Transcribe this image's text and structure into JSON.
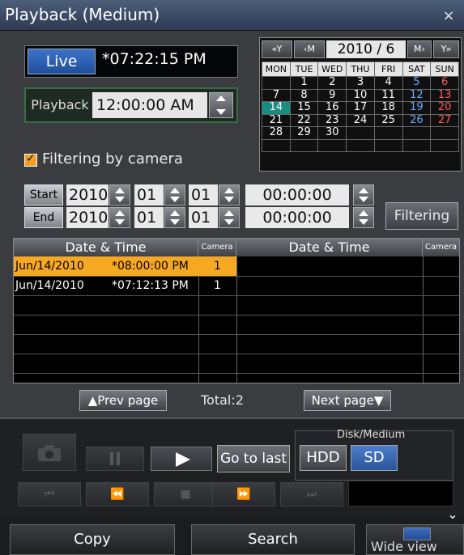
{
  "window": {
    "title": "Playback (Medium)",
    "close_icon": "×"
  },
  "live": {
    "button_label": "Live",
    "time": "*07:22:15 PM"
  },
  "playback": {
    "label": "Playback",
    "time": "12:00:00 AM"
  },
  "calendar": {
    "nav": {
      "prev_year": "«Y",
      "prev_month": "‹M",
      "next_month": "M›",
      "next_year": "Y»"
    },
    "year_month": "2010 /   6",
    "weekdays": [
      "MON",
      "TUE",
      "WED",
      "THU",
      "FRI",
      "SAT",
      "SUN"
    ],
    "weeks": [
      [
        "",
        "1",
        "2",
        "3",
        "4",
        "5",
        "6"
      ],
      [
        "7",
        "8",
        "9",
        "10",
        "11",
        "12",
        "13"
      ],
      [
        "14",
        "15",
        "16",
        "17",
        "18",
        "19",
        "20"
      ],
      [
        "21",
        "22",
        "23",
        "24",
        "25",
        "26",
        "27"
      ],
      [
        "28",
        "29",
        "30",
        "",
        "",
        "",
        ""
      ],
      [
        "",
        "",
        "",
        "",
        "",
        "",
        ""
      ]
    ],
    "selected_day": "14",
    "colors": {
      "saturday": "#6aa7ff",
      "sunday": "#ff5a5a",
      "selected_bg": "#1a8c82"
    }
  },
  "filter_by_camera": {
    "label": "Filtering by camera",
    "checked": true
  },
  "start": {
    "label": "Start",
    "year": "2010",
    "month": "01",
    "day": "01",
    "time": "00:00:00"
  },
  "end": {
    "label": "End",
    "year": "2010",
    "month": "01",
    "day": "01",
    "time": "00:00:00"
  },
  "filtering_button": "Filtering",
  "list": {
    "headers": {
      "datetime": "Date & Time",
      "camera": "Camera"
    },
    "rows": [
      {
        "date": "Jun/14/2010",
        "time": "*08:00:00 PM",
        "camera": "1",
        "selected": true
      },
      {
        "date": "Jun/14/2010",
        "time": "*07:12:13 PM",
        "camera": "1",
        "selected": false
      }
    ],
    "selected_color": "#f7a823"
  },
  "pager": {
    "prev": "Prev page",
    "total": "Total:2",
    "next": "Next page"
  },
  "controls": {
    "go_to_last": "Go to last",
    "disk_label": "Disk/Medium",
    "hdd": "HDD",
    "sd": "SD"
  },
  "bottom": {
    "copy": "Copy",
    "search": "Search",
    "wide_view": "Wide view"
  }
}
